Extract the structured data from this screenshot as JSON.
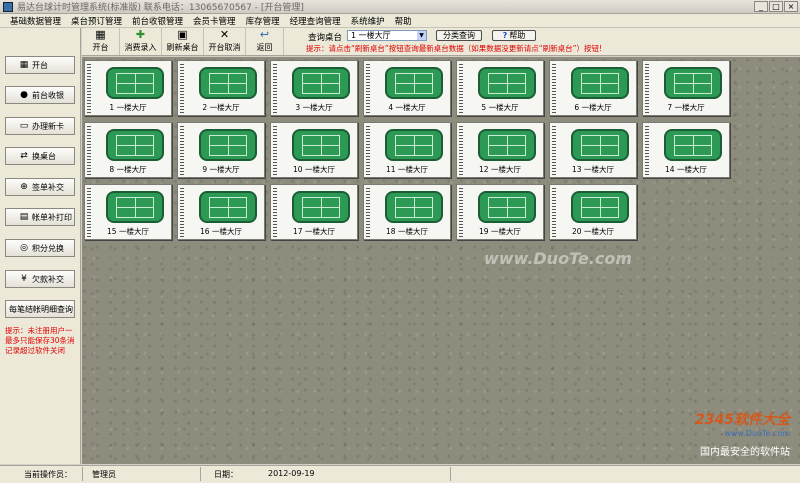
{
  "window": {
    "title": "易达台球计时管理系统(标准版)  联系电话：13065670567  - [开台管理]"
  },
  "menubar": {
    "items": [
      "基础数据管理",
      "桌台预订管理",
      "前台收银管理",
      "会员卡管理",
      "库存管理",
      "经理查询管理",
      "系统维护",
      "帮助"
    ]
  },
  "toolbar": {
    "buttons": [
      {
        "label": "开台",
        "icon": "open-table-icon"
      },
      {
        "label": "消费录入",
        "icon": "consume-entry-icon"
      },
      {
        "label": "刷新桌台",
        "icon": "refresh-icon"
      },
      {
        "label": "开台取消",
        "icon": "cancel-x-icon"
      },
      {
        "label": "返回",
        "icon": "return-icon"
      }
    ],
    "query_label": "查询桌台",
    "query_value": "1 一楼大厅",
    "classify_label": "分类查询",
    "help_label": "帮助",
    "hint": "提示：请点击“刷新桌台”按钮查询最新桌台数据（如果数据没更新请点“刷新桌台”）按钮!"
  },
  "sidebar": {
    "buttons": [
      {
        "label": "开台",
        "icon": "open-table-icon"
      },
      {
        "label": "前台收银",
        "icon": "cashier-icon"
      },
      {
        "label": "办理新卡",
        "icon": "new-card-icon"
      },
      {
        "label": "换桌台",
        "icon": "swap-table-icon"
      },
      {
        "label": "签单补交",
        "icon": "bill-supplement-icon"
      },
      {
        "label": "帐单补打印",
        "icon": "reprint-icon"
      },
      {
        "label": "积分兑换",
        "icon": "points-exchange-icon"
      },
      {
        "label": "欠款补交",
        "icon": "debt-payment-icon"
      },
      {
        "label": "每笔结帐明细查询",
        "icon": ""
      }
    ],
    "hint": "提示：未注册用户一最多只能保存30条消记录超过软件关闭"
  },
  "tables": [
    {
      "label": "1  一楼大厅"
    },
    {
      "label": "2  一楼大厅"
    },
    {
      "label": "3  一楼大厅"
    },
    {
      "label": "4  一楼大厅"
    },
    {
      "label": "5  一楼大厅"
    },
    {
      "label": "6  一楼大厅"
    },
    {
      "label": "7  一楼大厅"
    },
    {
      "label": "8  一楼大厅"
    },
    {
      "label": "9  一楼大厅"
    },
    {
      "label": "10  一楼大厅"
    },
    {
      "label": "11  一楼大厅"
    },
    {
      "label": "12  一楼大厅"
    },
    {
      "label": "13  一楼大厅"
    },
    {
      "label": "14  一楼大厅"
    },
    {
      "label": "15  一楼大厅"
    },
    {
      "label": "16  一楼大厅"
    },
    {
      "label": "17  一楼大厅"
    },
    {
      "label": "18  一楼大厅"
    },
    {
      "label": "19  一楼大厅"
    },
    {
      "label": "20  一楼大厅"
    }
  ],
  "statusbar": {
    "operator_label": "当前操作员：",
    "operator_value": "管理员",
    "date_label": "日期：",
    "date_value": "2012-09-19"
  },
  "watermark": "www.DuoTe.com",
  "logo": {
    "main": "2345软件大全",
    "sub": "www.DuoTe.com",
    "slogan": "国内最安全的软件站"
  }
}
